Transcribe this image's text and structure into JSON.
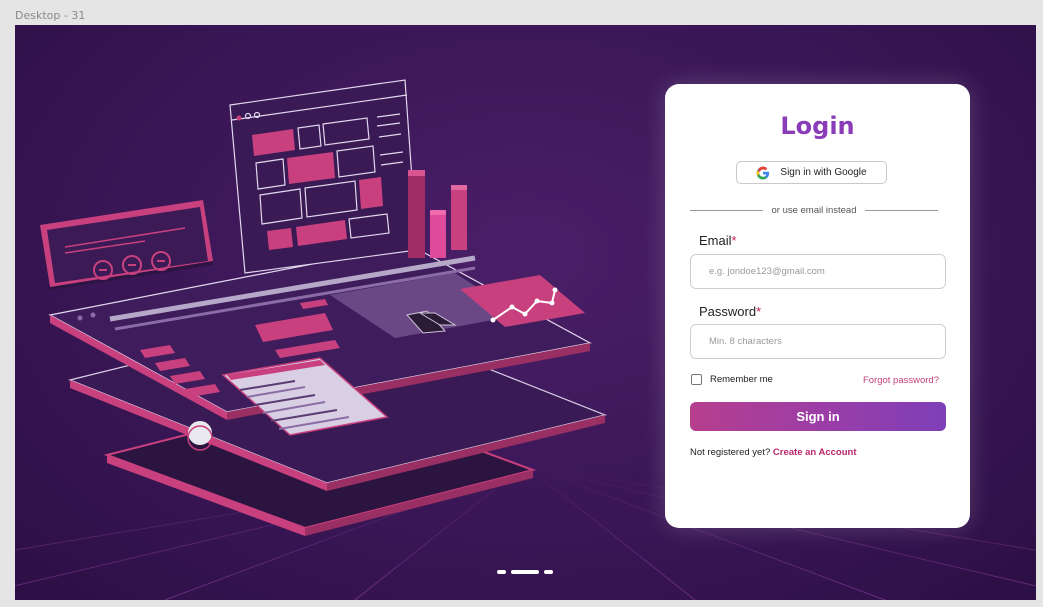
{
  "frame": {
    "label": "Desktop - 31"
  },
  "colors": {
    "accent": "#8a3bb8",
    "link": "#c2407a",
    "required": "#c2205a",
    "background": "#3a1656"
  },
  "login": {
    "title": "Login",
    "google_button": {
      "label": "Sign in with Google",
      "icon": "google-icon"
    },
    "divider_text": "or use email instead",
    "email": {
      "label": "Email",
      "required_mark": "*",
      "placeholder": "e.g. jondoe123@gmail.com",
      "value": ""
    },
    "password": {
      "label": "Password",
      "required_mark": "*",
      "placeholder": "Min. 8 characters",
      "value": ""
    },
    "remember_me": {
      "label": "Remember me",
      "checked": false
    },
    "forgot_password": "Forgot password?",
    "sign_in_button": "Sign in",
    "register": {
      "prompt": "Not registered yet?",
      "link": "Create an Account"
    }
  },
  "carousel": {
    "slides": 3,
    "active": 2
  }
}
